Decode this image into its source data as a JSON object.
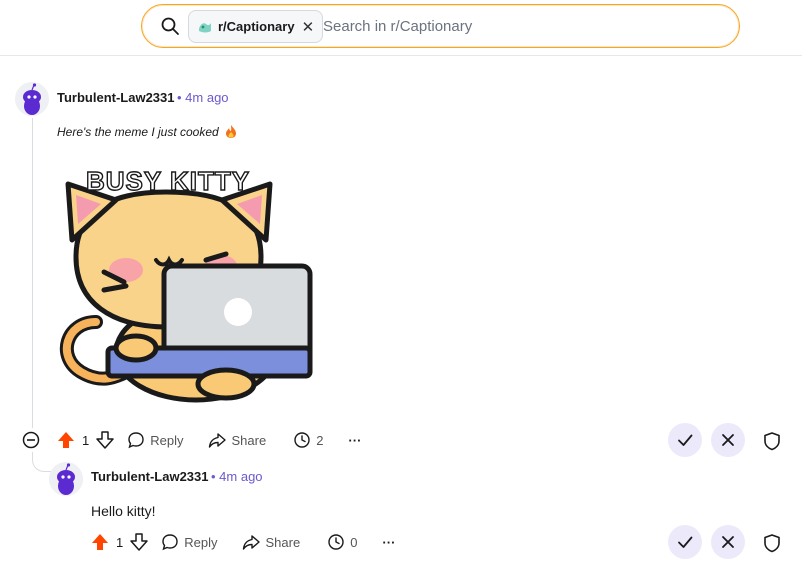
{
  "search": {
    "chip_label": "r/Captionary",
    "placeholder": "Search in r/Captionary"
  },
  "comment": {
    "username": "Turbulent-Law2331",
    "time": "• 4m ago",
    "text": "Here's the meme I just cooked",
    "meme_caption": "BUSY KITTY",
    "upvotes": "1",
    "reply_label": "Reply",
    "share_label": "Share",
    "award_count": "2",
    "more_label": "···"
  },
  "reply": {
    "username": "Turbulent-Law2331",
    "time": "• 4m ago",
    "text": "Hello kitty!",
    "upvotes": "1",
    "reply_label": "Reply",
    "share_label": "Share",
    "award_count": "0",
    "more_label": "···"
  },
  "colors": {
    "upvote": "#ff4500",
    "accent": "#6a5acd",
    "mod_button_bg": "#ece9fb",
    "search_border": "#f5a623"
  }
}
